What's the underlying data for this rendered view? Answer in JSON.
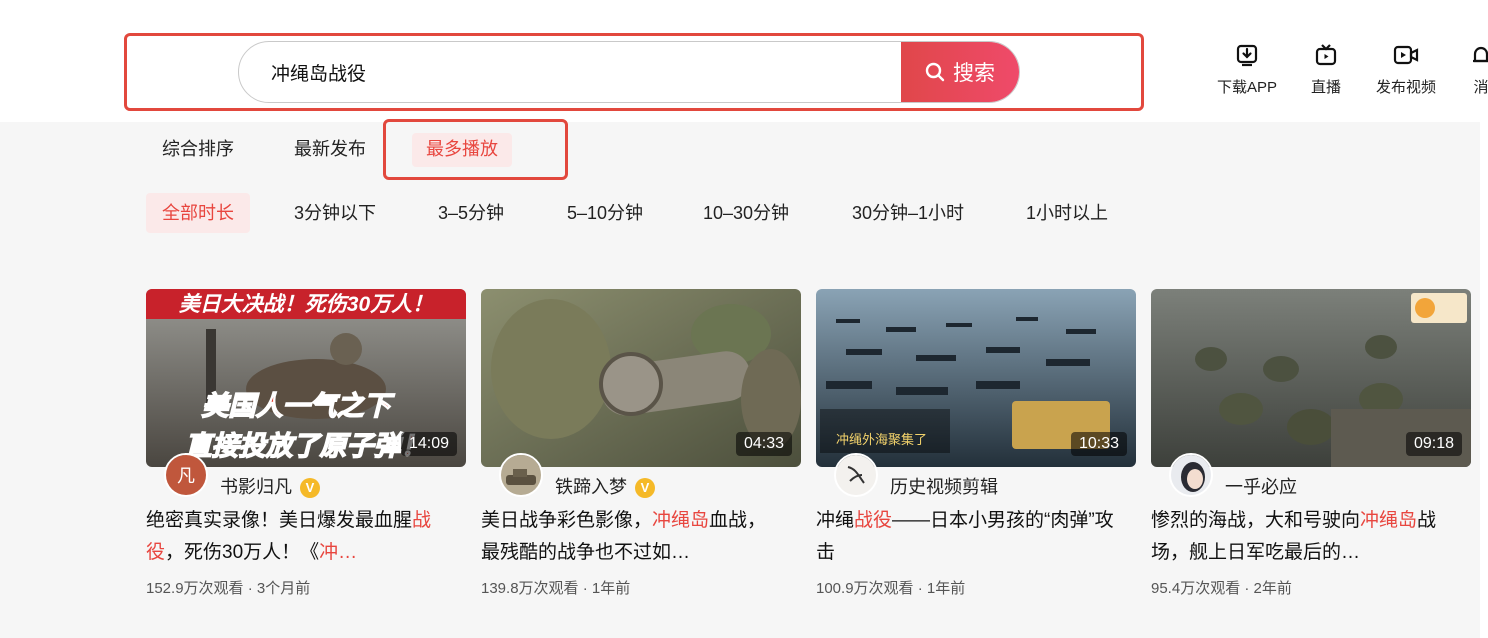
{
  "search": {
    "query": "冲绳岛战役",
    "button_label": "搜索"
  },
  "header_nav": [
    {
      "label": "下载APP",
      "icon": "download-icon"
    },
    {
      "label": "直播",
      "icon": "tv-icon"
    },
    {
      "label": "发布视频",
      "icon": "video-camera-icon"
    },
    {
      "label": "消",
      "icon": "bell-icon"
    }
  ],
  "sort_tabs": [
    {
      "label": "综合排序",
      "active": false
    },
    {
      "label": "最新发布",
      "active": false
    },
    {
      "label": "最多播放",
      "active": true
    }
  ],
  "durations": [
    {
      "label": "全部时长",
      "active": true
    },
    {
      "label": "3分钟以下",
      "active": false
    },
    {
      "label": "3–5分钟",
      "active": false
    },
    {
      "label": "5–10分钟",
      "active": false
    },
    {
      "label": "10–30分钟",
      "active": false
    },
    {
      "label": "30分钟–1小时",
      "active": false
    },
    {
      "label": "1小时以上",
      "active": false
    }
  ],
  "videos": [
    {
      "duration": "14:09",
      "author": "书影归凡",
      "verified": true,
      "title_parts": [
        "绝密真实录像！美日爆发最血腥",
        "战役",
        "，死伤30万人！《",
        "冲…",
        ""
      ],
      "meta": "152.9万次观看 · 3个月前",
      "thumb_text_top": "美日大决战！死伤30万人！",
      "thumb_text_bottom_1": "美国人一气之下",
      "thumb_text_bottom_2": "直接投放了原子弹！"
    },
    {
      "duration": "04:33",
      "author": "铁蹄入梦",
      "verified": true,
      "title_parts": [
        "美日战争彩色影像，",
        "冲绳岛",
        "血战，最残酷的战争也不过如…",
        "",
        ""
      ],
      "meta": "139.8万次观看 · 1年前"
    },
    {
      "duration": "10:33",
      "author": "历史视频剪辑",
      "verified": false,
      "title_parts": [
        "冲绳",
        "战役",
        "——日本小男孩的“肉弹”攻击",
        "",
        ""
      ],
      "meta": "100.9万次观看 · 1年前",
      "thumb_text": "冲绳外海聚集了"
    },
    {
      "duration": "09:18",
      "author": "一乎必应",
      "verified": false,
      "title_parts": [
        "惨烈的海战，大和号驶向",
        "冲绳岛",
        "战场，舰上日军吃最后的…",
        "",
        ""
      ],
      "meta": "95.4万次观看 · 2年前"
    }
  ],
  "colors": {
    "accent": "#e8463f",
    "highlight_box": "#e2483d",
    "tab_active_bg": "#fbe9e9",
    "verified": "#f5b928"
  }
}
